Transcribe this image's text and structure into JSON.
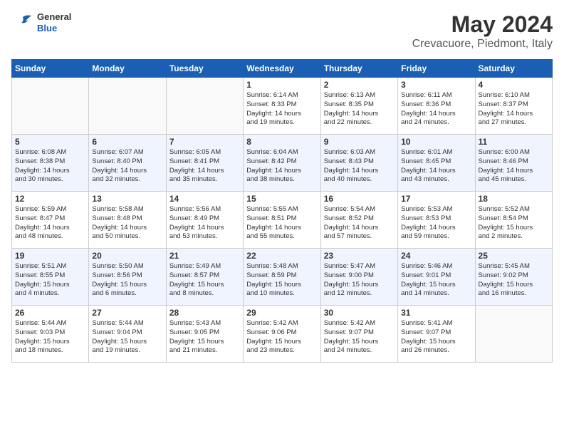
{
  "header": {
    "logo_line1": "General",
    "logo_line2": "Blue",
    "month": "May 2024",
    "location": "Crevacuore, Piedmont, Italy"
  },
  "weekdays": [
    "Sunday",
    "Monday",
    "Tuesday",
    "Wednesday",
    "Thursday",
    "Friday",
    "Saturday"
  ],
  "weeks": [
    [
      {
        "day": "",
        "info": ""
      },
      {
        "day": "",
        "info": ""
      },
      {
        "day": "",
        "info": ""
      },
      {
        "day": "1",
        "info": "Sunrise: 6:14 AM\nSunset: 8:33 PM\nDaylight: 14 hours\nand 19 minutes."
      },
      {
        "day": "2",
        "info": "Sunrise: 6:13 AM\nSunset: 8:35 PM\nDaylight: 14 hours\nand 22 minutes."
      },
      {
        "day": "3",
        "info": "Sunrise: 6:11 AM\nSunset: 8:36 PM\nDaylight: 14 hours\nand 24 minutes."
      },
      {
        "day": "4",
        "info": "Sunrise: 6:10 AM\nSunset: 8:37 PM\nDaylight: 14 hours\nand 27 minutes."
      }
    ],
    [
      {
        "day": "5",
        "info": "Sunrise: 6:08 AM\nSunset: 8:38 PM\nDaylight: 14 hours\nand 30 minutes."
      },
      {
        "day": "6",
        "info": "Sunrise: 6:07 AM\nSunset: 8:40 PM\nDaylight: 14 hours\nand 32 minutes."
      },
      {
        "day": "7",
        "info": "Sunrise: 6:05 AM\nSunset: 8:41 PM\nDaylight: 14 hours\nand 35 minutes."
      },
      {
        "day": "8",
        "info": "Sunrise: 6:04 AM\nSunset: 8:42 PM\nDaylight: 14 hours\nand 38 minutes."
      },
      {
        "day": "9",
        "info": "Sunrise: 6:03 AM\nSunset: 8:43 PM\nDaylight: 14 hours\nand 40 minutes."
      },
      {
        "day": "10",
        "info": "Sunrise: 6:01 AM\nSunset: 8:45 PM\nDaylight: 14 hours\nand 43 minutes."
      },
      {
        "day": "11",
        "info": "Sunrise: 6:00 AM\nSunset: 8:46 PM\nDaylight: 14 hours\nand 45 minutes."
      }
    ],
    [
      {
        "day": "12",
        "info": "Sunrise: 5:59 AM\nSunset: 8:47 PM\nDaylight: 14 hours\nand 48 minutes."
      },
      {
        "day": "13",
        "info": "Sunrise: 5:58 AM\nSunset: 8:48 PM\nDaylight: 14 hours\nand 50 minutes."
      },
      {
        "day": "14",
        "info": "Sunrise: 5:56 AM\nSunset: 8:49 PM\nDaylight: 14 hours\nand 53 minutes."
      },
      {
        "day": "15",
        "info": "Sunrise: 5:55 AM\nSunset: 8:51 PM\nDaylight: 14 hours\nand 55 minutes."
      },
      {
        "day": "16",
        "info": "Sunrise: 5:54 AM\nSunset: 8:52 PM\nDaylight: 14 hours\nand 57 minutes."
      },
      {
        "day": "17",
        "info": "Sunrise: 5:53 AM\nSunset: 8:53 PM\nDaylight: 14 hours\nand 59 minutes."
      },
      {
        "day": "18",
        "info": "Sunrise: 5:52 AM\nSunset: 8:54 PM\nDaylight: 15 hours\nand 2 minutes."
      }
    ],
    [
      {
        "day": "19",
        "info": "Sunrise: 5:51 AM\nSunset: 8:55 PM\nDaylight: 15 hours\nand 4 minutes."
      },
      {
        "day": "20",
        "info": "Sunrise: 5:50 AM\nSunset: 8:56 PM\nDaylight: 15 hours\nand 6 minutes."
      },
      {
        "day": "21",
        "info": "Sunrise: 5:49 AM\nSunset: 8:57 PM\nDaylight: 15 hours\nand 8 minutes."
      },
      {
        "day": "22",
        "info": "Sunrise: 5:48 AM\nSunset: 8:59 PM\nDaylight: 15 hours\nand 10 minutes."
      },
      {
        "day": "23",
        "info": "Sunrise: 5:47 AM\nSunset: 9:00 PM\nDaylight: 15 hours\nand 12 minutes."
      },
      {
        "day": "24",
        "info": "Sunrise: 5:46 AM\nSunset: 9:01 PM\nDaylight: 15 hours\nand 14 minutes."
      },
      {
        "day": "25",
        "info": "Sunrise: 5:45 AM\nSunset: 9:02 PM\nDaylight: 15 hours\nand 16 minutes."
      }
    ],
    [
      {
        "day": "26",
        "info": "Sunrise: 5:44 AM\nSunset: 9:03 PM\nDaylight: 15 hours\nand 18 minutes."
      },
      {
        "day": "27",
        "info": "Sunrise: 5:44 AM\nSunset: 9:04 PM\nDaylight: 15 hours\nand 19 minutes."
      },
      {
        "day": "28",
        "info": "Sunrise: 5:43 AM\nSunset: 9:05 PM\nDaylight: 15 hours\nand 21 minutes."
      },
      {
        "day": "29",
        "info": "Sunrise: 5:42 AM\nSunset: 9:06 PM\nDaylight: 15 hours\nand 23 minutes."
      },
      {
        "day": "30",
        "info": "Sunrise: 5:42 AM\nSunset: 9:07 PM\nDaylight: 15 hours\nand 24 minutes."
      },
      {
        "day": "31",
        "info": "Sunrise: 5:41 AM\nSunset: 9:07 PM\nDaylight: 15 hours\nand 26 minutes."
      },
      {
        "day": "",
        "info": ""
      }
    ]
  ]
}
